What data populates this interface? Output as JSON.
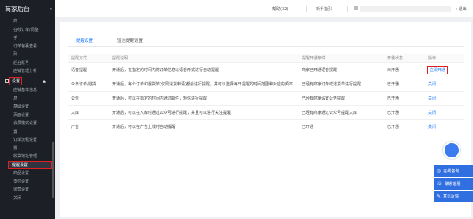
{
  "sidebar": {
    "brand": "商家后台",
    "collapse_icon": "«",
    "items": [
      {
        "type": "sub",
        "label": "商"
      },
      {
        "type": "sub",
        "label": "在线订单/调整"
      },
      {
        "type": "sub",
        "label": "手"
      },
      {
        "type": "sub",
        "label": "订单包裹查看"
      },
      {
        "type": "sub",
        "label": "列"
      },
      {
        "type": "sub",
        "label": "后台账号"
      },
      {
        "type": "sub",
        "label": "店铺管理分析"
      },
      {
        "type": "groupred",
        "label": "设置",
        "arrow": "▲"
      },
      {
        "type": "sub",
        "label": "店铺基本信息"
      },
      {
        "type": "sub",
        "label": "息"
      },
      {
        "type": "sub",
        "label": "基础设置"
      },
      {
        "type": "sub",
        "label": "页面设置"
      },
      {
        "type": "sub",
        "label": "会员模式设置"
      },
      {
        "type": "sub",
        "label": "置"
      },
      {
        "type": "sub",
        "label": "订单流程设置"
      },
      {
        "type": "sub",
        "label": "置"
      },
      {
        "type": "sub",
        "label": "收货地址管理"
      },
      {
        "type": "active",
        "label": "提醒设置"
      },
      {
        "type": "sub",
        "label": "商品设置"
      },
      {
        "type": "sub",
        "label": "支付设置"
      },
      {
        "type": "sub",
        "label": "运营设置"
      },
      {
        "type": "sub",
        "label": "关闭"
      }
    ]
  },
  "topbar": {
    "help": "帮助(32)",
    "guide": "新手指引",
    "logout": "退出"
  },
  "tabs": [
    {
      "label": "提醒设置",
      "active": true
    },
    {
      "label": "短信提醒设置",
      "active": false
    }
  ],
  "table": {
    "headers": [
      "提醒方式",
      "提醒说明",
      "提醒开通条件",
      "开通状态",
      "操作"
    ],
    "rows": [
      {
        "c1": "语音提醒",
        "c2": "开通后，在指定的时间内将订单信息以语音形式进行自动提醒",
        "c3": "商家已开通语音提醒",
        "c4": "未开通",
        "op": "立即开通",
        "highlight": true
      },
      {
        "c1": "今日订单/退货",
        "c2": "开通后，每个订单和退货单(仅限退货申请)都会进行提醒，并可以选择每日提醒的时间范围和对应的频率",
        "c3": "已经有商家订单或退货单进行提醒",
        "c4": "已开通",
        "op": "关闭",
        "highlight": false
      },
      {
        "c1": "公告",
        "c2": "开通后，可以在指定的时间内通过邮件，短信进行提醒",
        "c3": "已经有商家设置公告提醒",
        "c4": "已开通",
        "op": "关闭",
        "highlight": false
      },
      {
        "c1": "入库",
        "c2": "开通后，可以在入库时通过公众号进行提醒，并且可以进行关注提醒",
        "c3": "已经有商家通过公众号提醒入库",
        "c4": "已开通",
        "op": "关闭",
        "highlight": false
      },
      {
        "c1": "广告",
        "c2": "开通后，可以在广告上线时自动提醒",
        "c3": "已开通",
        "c4": "已开通",
        "op": "关闭",
        "highlight": false
      }
    ]
  },
  "float_panel": {
    "btn1": "在线咨询",
    "btn2": "联系客服",
    "btn3": "意见反馈"
  }
}
